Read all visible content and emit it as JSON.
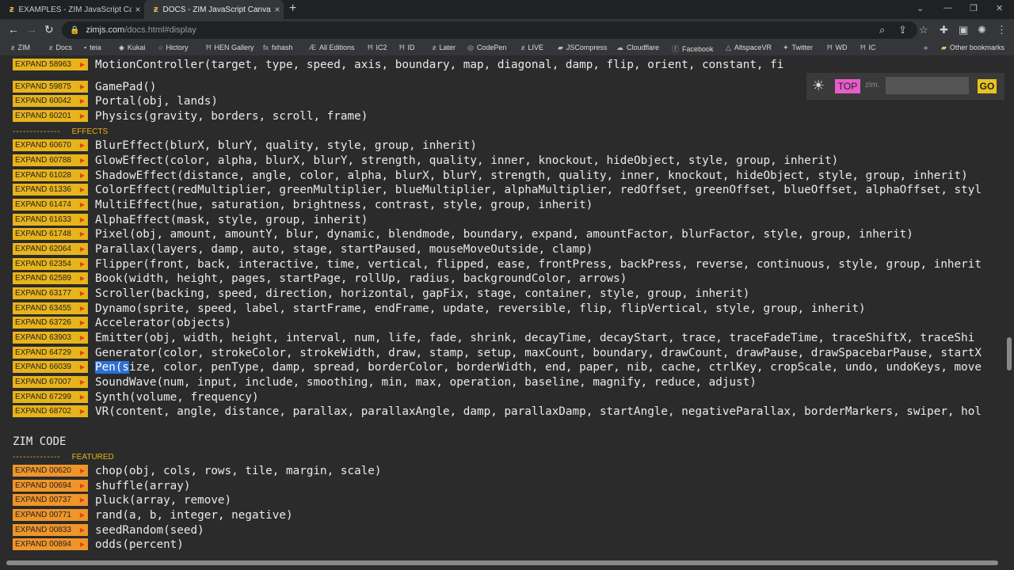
{
  "tabs": [
    {
      "title": "EXAMPLES - ZIM JavaScript Canva",
      "active": false
    },
    {
      "title": "DOCS - ZIM JavaScript Canvas Fr",
      "active": true
    }
  ],
  "address": {
    "host": "zimjs.com",
    "path": "/docs.html#display"
  },
  "bookmarks": [
    {
      "label": "ZIM",
      "icon": "zim-logo-icon"
    },
    {
      "label": "Docs",
      "icon": "zim-logo-icon"
    },
    {
      "label": "teia",
      "icon": "teia-icon"
    },
    {
      "label": "Kukai",
      "icon": "kukai-icon"
    },
    {
      "label": "Hictory",
      "icon": "circle-icon"
    },
    {
      "label": "HEN Gallery",
      "icon": "hen-icon"
    },
    {
      "label": "fxhash",
      "icon": "fx-icon"
    },
    {
      "label": "All Editions",
      "icon": "editions-icon"
    },
    {
      "label": "IC2",
      "icon": "hen-icon"
    },
    {
      "label": "ID",
      "icon": "hen-icon"
    },
    {
      "label": "Later",
      "icon": "zim-logo-icon"
    },
    {
      "label": "CodePen",
      "icon": "codepen-icon"
    },
    {
      "label": "LIVE",
      "icon": "zim-logo-icon"
    },
    {
      "label": "JSCompress",
      "icon": "folder-icon"
    },
    {
      "label": "Cloudflare",
      "icon": "cloud-icon"
    },
    {
      "label": "Facebook",
      "icon": "facebook-icon"
    },
    {
      "label": "AltspaceVR",
      "icon": "altspace-icon"
    },
    {
      "label": "Twitter",
      "icon": "twitter-icon"
    },
    {
      "label": "WD",
      "icon": "hen-icon"
    },
    {
      "label": "IC",
      "icon": "hen-icon"
    },
    {
      "label": "Other bookmarks",
      "icon": "folder-icon"
    }
  ],
  "widget": {
    "top_label": "TOP",
    "zim_label": "zim.",
    "go_label": "GO",
    "search_value": ""
  },
  "rows": [
    {
      "code": "EXPAND 58963",
      "sig": "MotionController(target, type, speed, axis, boundary, map, diagonal, damp, flip, orient, constant, fi"
    },
    {
      "code": "EXPAND 59875",
      "sig": "GamePad()"
    },
    {
      "code": "EXPAND 60042",
      "sig": "Portal(obj, lands)"
    },
    {
      "code": "EXPAND 60201",
      "sig": "Physics(gravity, borders, scroll, frame)"
    },
    {
      "code": "EXPAND 60670",
      "sig": "BlurEffect(blurX, blurY, quality, style, group, inherit)"
    },
    {
      "code": "EXPAND 60788",
      "sig": "GlowEffect(color, alpha, blurX, blurY, strength, quality, inner, knockout, hideObject, style, group, inherit)"
    },
    {
      "code": "EXPAND 61028",
      "sig": "ShadowEffect(distance, angle, color, alpha, blurX, blurY, strength, quality, inner, knockout, hideObject, style, group, inherit)"
    },
    {
      "code": "EXPAND 61336",
      "sig": "ColorEffect(redMultiplier, greenMultiplier, blueMultiplier, alphaMultiplier, redOffset, greenOffset, blueOffset, alphaOffset, styl"
    },
    {
      "code": "EXPAND 61474",
      "sig": "MultiEffect(hue, saturation, brightness, contrast, style, group, inherit)"
    },
    {
      "code": "EXPAND 61633",
      "sig": "AlphaEffect(mask, style, group, inherit)"
    },
    {
      "code": "EXPAND 61748",
      "sig": "Pixel(obj, amount, amountY, blur, dynamic, blendmode, boundary, expand, amountFactor, blurFactor, style, group, inherit)"
    },
    {
      "code": "EXPAND 62064",
      "sig": "Parallax(layers, damp, auto, stage, startPaused, mouseMoveOutside, clamp)"
    },
    {
      "code": "EXPAND 62354",
      "sig": "Flipper(front, back, interactive, time, vertical, flipped, ease, frontPress, backPress, reverse, continuous, style, group, inherit"
    },
    {
      "code": "EXPAND 62589",
      "sig": "Book(width, height, pages, startPage, rollUp, radius, backgroundColor, arrows)"
    },
    {
      "code": "EXPAND 63177",
      "sig": "Scroller(backing, speed, direction, horizontal, gapFix, stage, container, style, group, inherit)"
    },
    {
      "code": "EXPAND 63455",
      "sig": "Dynamo(sprite, speed, label, startFrame, endFrame, update, reversible, flip, flipVertical, style, group, inherit)"
    },
    {
      "code": "EXPAND 63726",
      "sig": "Accelerator(objects)"
    },
    {
      "code": "EXPAND 63903",
      "sig": "Emitter(obj, width, height, interval, num, life, fade, shrink, decayTime, decayStart, trace, traceFadeTime, traceShiftX, traceShi"
    },
    {
      "code": "EXPAND 64729",
      "sig": "Generator(color, strokeColor, strokeWidth, draw, stamp, setup, maxCount, boundary, drawCount, drawPause, drawSpacebarPause, startX"
    },
    {
      "code": "EXPAND 66039",
      "sig_hl": "Pen(s",
      "sig": "ize, color, penType, damp, spread, borderColor, borderWidth, end, paper, nib, cache, ctrlKey, cropScale, undo, undoKeys, move"
    },
    {
      "code": "EXPAND 67007",
      "sig": "SoundWave(num, input, include, smoothing, min, max, operation, baseline, magnify, reduce, adjust)"
    },
    {
      "code": "EXPAND 67299",
      "sig": "Synth(volume, frequency)"
    },
    {
      "code": "EXPAND 68702",
      "sig": "VR(content, angle, distance, parallax, parallaxAngle, damp, parallaxDamp, startAngle, negativeParallax, borderMarkers, swiper, hol"
    }
  ],
  "effects_label": "EFFECTS",
  "section_title": "ZIM CODE",
  "featured_label": "FEATURED",
  "code_rows": [
    {
      "code": "EXPAND 00620",
      "sig": "chop(obj, cols, rows, tile, margin, scale)"
    },
    {
      "code": "EXPAND 00694",
      "sig": "shuffle(array)"
    },
    {
      "code": "EXPAND 00737",
      "sig": "pluck(array, remove)"
    },
    {
      "code": "EXPAND 00771",
      "sig": "rand(a, b, integer, negative)"
    },
    {
      "code": "EXPAND 00833",
      "sig": "seedRandom(seed)"
    },
    {
      "code": "EXPAND 00894",
      "sig": "odds(percent)"
    }
  ],
  "colors": {
    "expand_yellow": "#e8b41c",
    "expand_orange": "#f0952a",
    "top_pink": "#e85ccd",
    "go_yellow": "#e8c320",
    "background": "#2b2b2b"
  }
}
